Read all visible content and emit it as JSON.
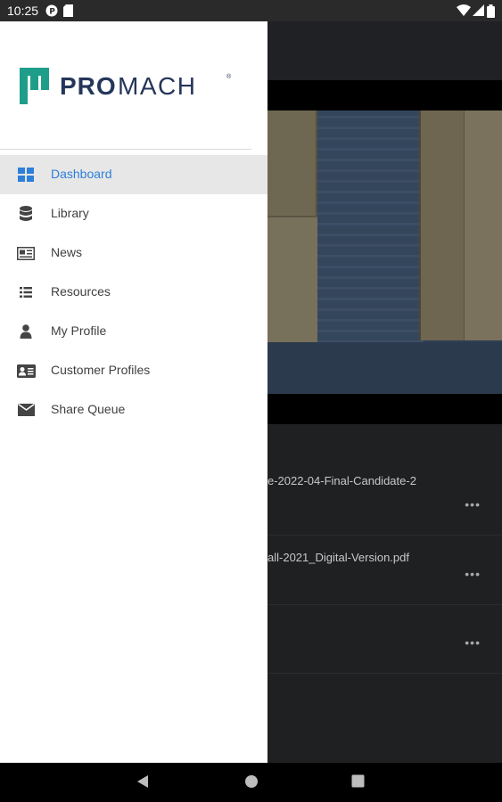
{
  "status_bar": {
    "time": "10:25",
    "left_icons": [
      "app-notification-icon",
      "sd-card-icon"
    ],
    "right_icons": [
      "wifi-icon",
      "cell-signal-icon",
      "battery-icon"
    ]
  },
  "drawer": {
    "brand": {
      "logo_text_bold": "PRO",
      "logo_text_light": "MACH",
      "logo_mark": "®",
      "logo_color": "#1e9e8a",
      "text_color": "#24365a"
    },
    "items": [
      {
        "label": "Dashboard",
        "icon": "dashboard-icon",
        "active": true
      },
      {
        "label": "Library",
        "icon": "database-icon",
        "active": false
      },
      {
        "label": "News",
        "icon": "newspaper-icon",
        "active": false
      },
      {
        "label": "Resources",
        "icon": "list-icon",
        "active": false
      },
      {
        "label": "My Profile",
        "icon": "person-icon",
        "active": false
      },
      {
        "label": "Customer Profiles",
        "icon": "id-card-icon",
        "active": false
      },
      {
        "label": "Share Queue",
        "icon": "envelope-icon",
        "active": false
      }
    ],
    "active_color": "#2e7fd9"
  },
  "background": {
    "list_rows": [
      {
        "text": "e-2022-04-Final-Candidate-2",
        "more": "•••"
      },
      {
        "text": "all-2021_Digital-Version.pdf",
        "more": "•••"
      },
      {
        "text": "",
        "more": "•••"
      }
    ]
  },
  "system_nav": [
    "back-icon",
    "home-icon",
    "recents-icon"
  ]
}
